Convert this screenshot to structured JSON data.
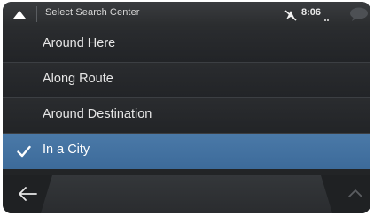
{
  "header": {
    "title": "Select Search Center",
    "collapse_icon": "chevron-up-icon",
    "gps_status_icon": "gps-off-icon",
    "time": "8:06",
    "message_icon": "speech-bubble-icon"
  },
  "options": [
    {
      "label": "Around Here",
      "selected": false
    },
    {
      "label": "Along Route",
      "selected": false
    },
    {
      "label": "Around Destination",
      "selected": false
    },
    {
      "label": "In a City",
      "selected": true
    }
  ],
  "footer": {
    "back_icon": "arrow-left-icon",
    "scroll_up_icon": "chevron-up-icon"
  },
  "colors": {
    "selected_row": "#3d6b9a",
    "background": "#222426",
    "text": "#e6e6e6"
  }
}
